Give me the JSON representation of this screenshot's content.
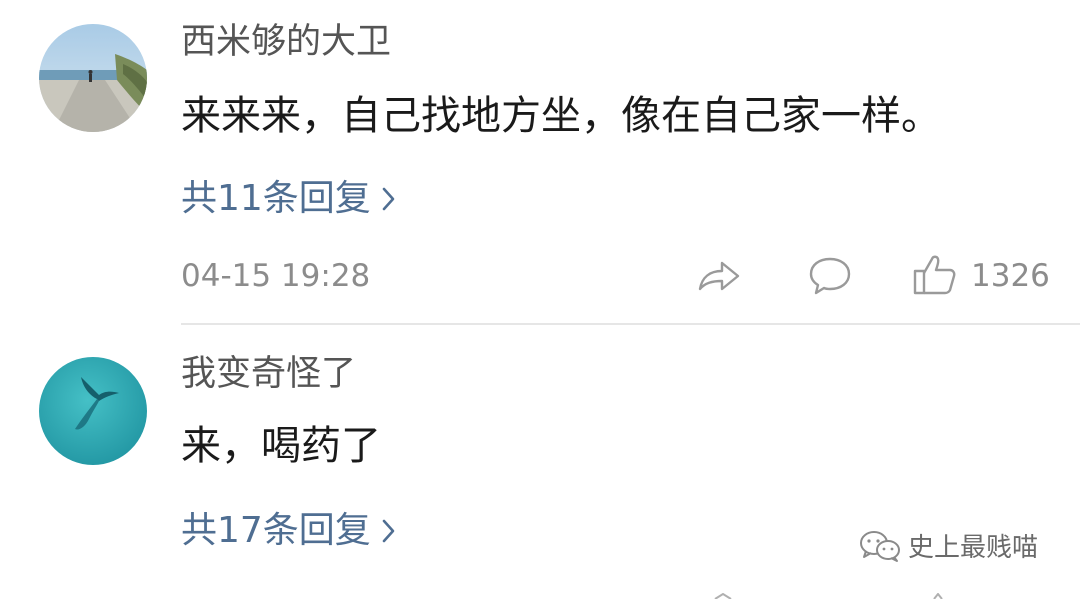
{
  "comments": [
    {
      "username": "西米够的大卫",
      "content": "来来来，自己找地方坐，像在自己家一样。",
      "replies_label": "共11条回复",
      "timestamp": "04-15 19:28",
      "like_count": "1326",
      "avatar_icon": "beach-road-photo"
    },
    {
      "username": "我变奇怪了",
      "content": "来，喝药了",
      "replies_label": "共17条回复",
      "avatar_icon": "whale-tail-photo"
    }
  ],
  "icons": {
    "share": "share-arrow-icon",
    "reply": "speech-bubble-icon",
    "like": "thumbs-up-icon",
    "chevron": "chevron-right-icon"
  },
  "watermark": {
    "text": "史上最贱喵",
    "icon": "wechat-icon"
  },
  "colors": {
    "link": "#4f6e92",
    "muted": "#8c8c8c",
    "username": "#555555",
    "text": "#1a1a1a",
    "divider": "#e6e6e6"
  }
}
